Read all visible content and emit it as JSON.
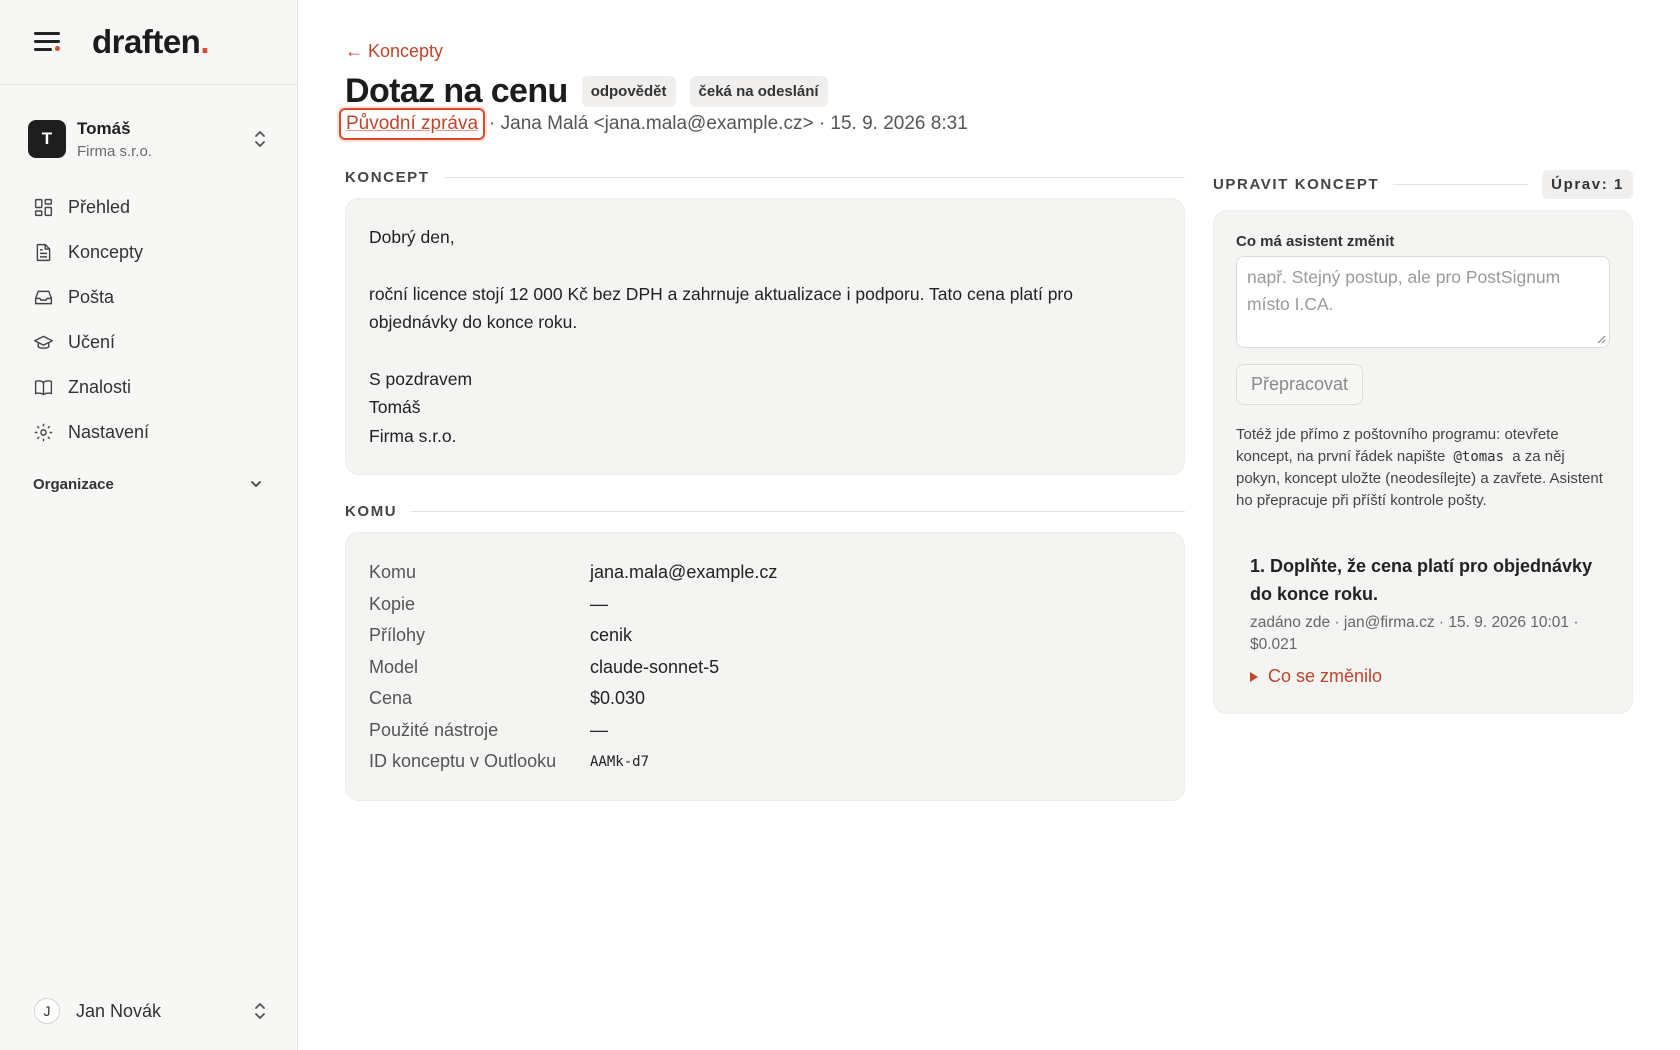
{
  "app": {
    "brand": "draften",
    "brand_dot": "."
  },
  "account": {
    "initial": "T",
    "name": "Tomáš",
    "org": "Firma s.r.o."
  },
  "nav": [
    {
      "label": "Přehled",
      "icon": "dashboard-icon"
    },
    {
      "label": "Koncepty",
      "icon": "document-icon"
    },
    {
      "label": "Pošta",
      "icon": "inbox-icon"
    },
    {
      "label": "Učení",
      "icon": "graduation-cap-icon"
    },
    {
      "label": "Znalosti",
      "icon": "book-icon"
    },
    {
      "label": "Nastavení",
      "icon": "gear-icon"
    }
  ],
  "org_toggle": "Organizace",
  "user": {
    "initial": "J",
    "name": "Jan Novák"
  },
  "page": {
    "back": "← Koncepty",
    "title": "Dotaz na cenu",
    "badges": [
      "odpovědět",
      "čeká na odeslání"
    ],
    "original_link": "Původní zpráva",
    "meta": "· Jana Malá <jana.mala@example.cz> · 15. 9. 2026 8:31"
  },
  "draft": {
    "section": "KONCEPT",
    "greeting": "Dobrý den,",
    "body": "roční licence stojí 12 000 Kč bez DPH a zahrnuje aktualizace i podporu. Tato cena platí pro objednávky do konce roku.",
    "closing": "S pozdravem",
    "sign_name": "Tomáš",
    "sign_org": "Firma s.r.o."
  },
  "recipients": {
    "section": "KOMU",
    "rows": [
      {
        "k": "Komu",
        "v": "jana.mala@example.cz"
      },
      {
        "k": "Kopie",
        "v": "—"
      },
      {
        "k": "Přílohy",
        "v": "cenik"
      },
      {
        "k": "Model",
        "v": "claude-sonnet-5"
      },
      {
        "k": "Cena",
        "v": "$0.030"
      },
      {
        "k": "Použité nástroje",
        "v": "—"
      },
      {
        "k": "ID konceptu v Outlooku",
        "v": "AAMk-d7"
      }
    ]
  },
  "edit": {
    "section": "UPRAVIT KONCEPT",
    "edits_count": "Úprav: 1",
    "field_label": "Co má asistent změnit",
    "placeholder": "např. Stejný postup, ale pro PostSignum místo I.CA.",
    "button": "Přepracovat",
    "help_before": "Totéž jde přímo z poštovního programu: otevřete koncept, na první řádek napište",
    "help_code": "@tomas",
    "help_after": "a za něj pokyn, koncept uložte (neodesílejte) a zavřete. Asistent ho přepracuje při příští kontrole pošty.",
    "history": [
      {
        "title": "1. Doplňte, že cena platí pro objednávky do konce roku.",
        "meta": "zadáno zde · jan@firma.cz · 15. 9. 2026 10:01 · $0.021",
        "changed": "Co se změnilo"
      }
    ]
  },
  "colors": {
    "accent": "#d94a2e",
    "link": "#c2452b",
    "card": "#f4f4f3",
    "sidebar": "#f7f7f6"
  }
}
